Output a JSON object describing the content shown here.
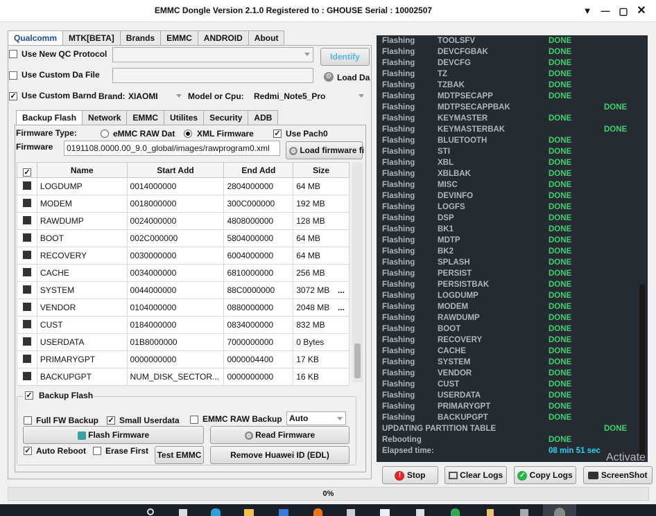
{
  "window": {
    "title": "EMMC Dongle Version 2.1.0 Registered to : GHOUSE   Serial : 10002507"
  },
  "main_tabs": [
    "Qualcomm",
    "MTK[BETA]",
    "Brands",
    "EMMC",
    "ANDROID",
    "About"
  ],
  "qc": {
    "use_new_qc_protocol": "Use New QC Protocol",
    "identify": "Identify",
    "use_custom_da_file": "Use Custom Da File",
    "load_da": "Load Da",
    "use_custom_brand": "Use Custom Barnd",
    "brand_label": "Brand:",
    "brand_value": "XIAOMI",
    "model_label": "Model or Cpu:",
    "model_value": "Redmi_Note5_Pro"
  },
  "sub_tabs": [
    "Backup  Flash",
    "Network",
    "EMMC",
    "Utilites",
    "Security",
    "ADB"
  ],
  "firmware": {
    "type_label": "Firmware Type:",
    "emmc_raw": "eMMC RAW Dat",
    "xml_firmware": "XML Firmware",
    "use_patch": "Use Pach0",
    "firmware_label": "Firmware",
    "firmware_path": "0191108.0000.00_9.0_global/images/rawprogram0.xml",
    "load_firmware": "Load firmware fi"
  },
  "table": {
    "headers": [
      "Name",
      "Start Add",
      "End Add",
      "Size"
    ],
    "rows": [
      [
        "LOGDUMP",
        "0014000000",
        "2804000000",
        "64 MB",
        ""
      ],
      [
        "MODEM",
        "0018000000",
        "300C000000",
        "192 MB",
        ""
      ],
      [
        "RAWDUMP",
        "0024000000",
        "4808000000",
        "128 MB",
        ""
      ],
      [
        "BOOT",
        "002C000000",
        "5804000000",
        "64 MB",
        ""
      ],
      [
        "RECOVERY",
        "0030000000",
        "6004000000",
        "64 MB",
        ""
      ],
      [
        "CACHE",
        "0034000000",
        "6810000000",
        "256 MB",
        ""
      ],
      [
        "SYSTEM",
        "0044000000",
        "88C0000000",
        "3072 MB",
        "..."
      ],
      [
        "VENDOR",
        "0104000000",
        "0880000000",
        "2048 MB",
        "..."
      ],
      [
        "CUST",
        "0184000000",
        "0834000000",
        "832 MB",
        ""
      ],
      [
        "USERDATA",
        "01B8000000",
        "7000000000",
        "0 Bytes",
        ""
      ],
      [
        "PRIMARYGPT",
        "0000000000",
        "0000004400",
        "17 KB",
        ""
      ],
      [
        "BACKUPGPT",
        "NUM_DISK_SECTOR...",
        "0000000000",
        "16 KB",
        ""
      ]
    ]
  },
  "backup_flash": {
    "group_label": "Backup  Flash",
    "full_fw_backup": "Full FW Backup",
    "small_userdata": "Small Userdata",
    "emmc_raw_backup": "EMMC RAW Backup",
    "auto_value": "Auto",
    "flash_firmware": "Flash Firmware",
    "read_firmware": "Read Firmware",
    "auto_reboot": "Auto Reboot",
    "erase_first": "Erase First",
    "test_emmc": "Test EMMC",
    "remove_huawei": "Remove Huawei ID (EDL)"
  },
  "log": [
    [
      "Flashing",
      "TOOLSFV",
      "DONE",
      0
    ],
    [
      "Flashing",
      "DEVCFGBAK",
      "DONE",
      0
    ],
    [
      "Flashing",
      "DEVCFG",
      "DONE",
      0
    ],
    [
      "Flashing",
      "TZ",
      "DONE",
      0
    ],
    [
      "Flashing",
      "TZBAK",
      "DONE",
      0
    ],
    [
      "Flashing",
      "MDTPSECAPP",
      "DONE",
      0
    ],
    [
      "Flashing",
      "MDTPSECAPPBAK",
      "DONE",
      1
    ],
    [
      "Flashing",
      "KEYMASTER",
      "DONE",
      0
    ],
    [
      "Flashing",
      "KEYMASTERBAK",
      "DONE",
      1
    ],
    [
      "Flashing",
      "BLUETOOTH",
      "DONE",
      0
    ],
    [
      "Flashing",
      "STI",
      "DONE",
      0
    ],
    [
      "Flashing",
      "XBL",
      "DONE",
      0
    ],
    [
      "Flashing",
      "XBLBAK",
      "DONE",
      0
    ],
    [
      "Flashing",
      "MISC",
      "DONE",
      0
    ],
    [
      "Flashing",
      "DEVINFO",
      "DONE",
      0
    ],
    [
      "Flashing",
      "LOGFS",
      "DONE",
      0
    ],
    [
      "Flashing",
      "DSP",
      "DONE",
      0
    ],
    [
      "Flashing",
      "BK1",
      "DONE",
      0
    ],
    [
      "Flashing",
      "MDTP",
      "DONE",
      0
    ],
    [
      "Flashing",
      "BK2",
      "DONE",
      0
    ],
    [
      "Flashing",
      "SPLASH",
      "DONE",
      0
    ],
    [
      "Flashing",
      "PERSIST",
      "DONE",
      0
    ],
    [
      "Flashing",
      "PERSISTBAK",
      "DONE",
      0
    ],
    [
      "Flashing",
      "LOGDUMP",
      "DONE",
      0
    ],
    [
      "Flashing",
      "MODEM",
      "DONE",
      0
    ],
    [
      "Flashing",
      "RAWDUMP",
      "DONE",
      0
    ],
    [
      "Flashing",
      "BOOT",
      "DONE",
      0
    ],
    [
      "Flashing",
      "RECOVERY",
      "DONE",
      0
    ],
    [
      "Flashing",
      "CACHE",
      "DONE",
      0
    ],
    [
      "Flashing",
      "SYSTEM",
      "DONE",
      0
    ],
    [
      "Flashing",
      "VENDOR",
      "DONE",
      0
    ],
    [
      "Flashing",
      "CUST",
      "DONE",
      0
    ],
    [
      "Flashing",
      "USERDATA",
      "DONE",
      0
    ],
    [
      "Flashing",
      "PRIMARYGPT",
      "DONE",
      0
    ],
    [
      "Flashing",
      "BACKUPGPT",
      "DONE",
      0
    ],
    [
      "UPDATING PARTITION TABLE",
      "",
      "DONE",
      1
    ],
    [
      "Rebooting",
      "",
      "DONE",
      0
    ]
  ],
  "elapsed": {
    "label": "Elapsed time:",
    "value": "08 min  51 sec"
  },
  "bottom_buttons": {
    "stop": "Stop",
    "clear_logs": "Clear Logs",
    "copy_logs": "Copy Logs",
    "screenshot": "ScreenShot"
  },
  "watermark": "Activate",
  "progress": {
    "text": "0%",
    "fraction": 0
  }
}
